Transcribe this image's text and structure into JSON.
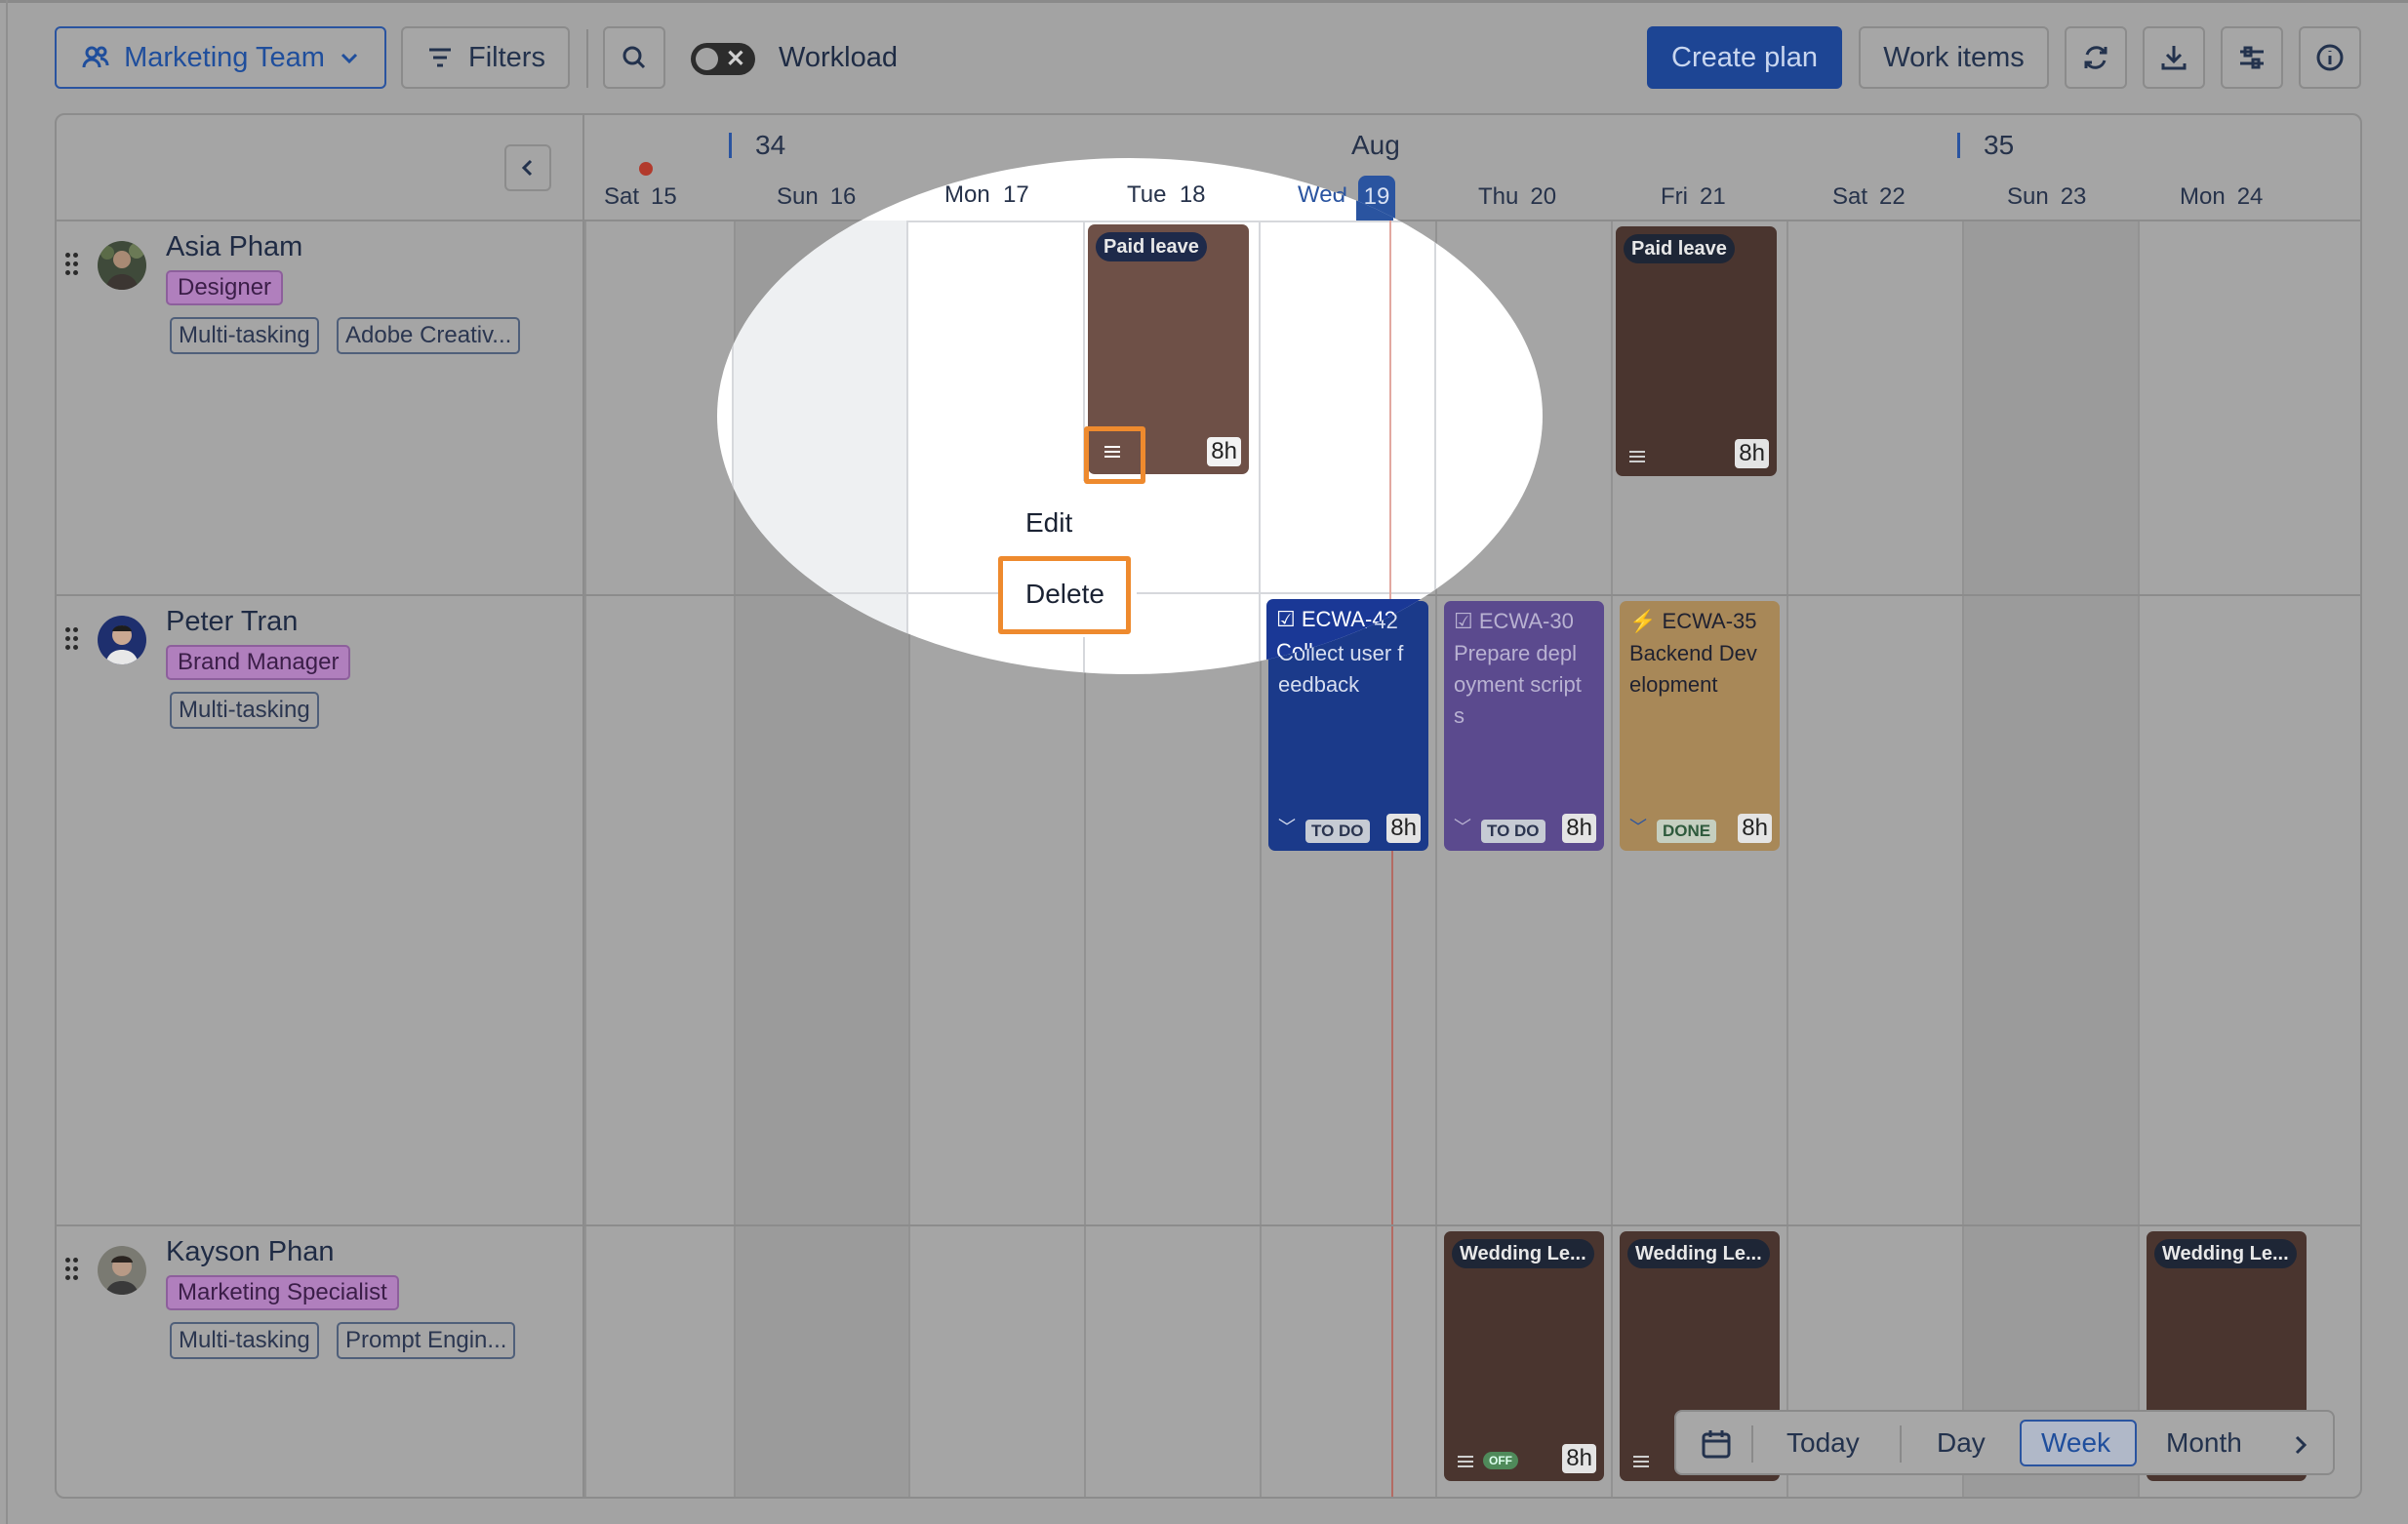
{
  "toolbar": {
    "team_label": "Marketing Team",
    "filters_label": "Filters",
    "workload_label": "Workload",
    "workload_toggle": "off",
    "create_plan_label": "Create plan",
    "work_items_label": "Work items",
    "icons": [
      "users-icon",
      "chevron-down-icon",
      "filter-icon",
      "search-icon",
      "refresh-icon",
      "download-icon",
      "settings-sliders-icon",
      "info-icon"
    ]
  },
  "timeline": {
    "month": "Aug",
    "weeks": [
      "34",
      "35"
    ],
    "days": [
      {
        "name": "Sat",
        "num": "15"
      },
      {
        "name": "Sun",
        "num": "16"
      },
      {
        "name": "Mon",
        "num": "17"
      },
      {
        "name": "Tue",
        "num": "18"
      },
      {
        "name": "Wed",
        "num": "19"
      },
      {
        "name": "Thu",
        "num": "20"
      },
      {
        "name": "Fri",
        "num": "21"
      },
      {
        "name": "Sat",
        "num": "22"
      },
      {
        "name": "Sun",
        "num": "23"
      },
      {
        "name": "Mon",
        "num": "24"
      }
    ],
    "today": "19"
  },
  "people": [
    {
      "name": "Asia Pham",
      "role": "Designer",
      "skills": [
        "Multi-tasking",
        "Adobe Creativ..."
      ]
    },
    {
      "name": "Peter Tran",
      "role": "Brand Manager",
      "skills": [
        "Multi-tasking"
      ]
    },
    {
      "name": "Kayson Phan",
      "role": "Marketing Specialist",
      "skills": [
        "Multi-tasking",
        "Prompt Engin..."
      ]
    }
  ],
  "cards": {
    "paid_leave_label": "Paid leave",
    "wedding_label": "Wedding Le...",
    "hours": "8h",
    "off_label": "OFF",
    "tasks": [
      {
        "key": "ECWA-42",
        "title": "Collect user f eedback",
        "status": "TO DO"
      },
      {
        "key": "ECWA-30",
        "title": "Prepare depl oyment script s",
        "status": "TO DO"
      },
      {
        "key": "ECWA-35",
        "title": "Backend Dev elopment",
        "status": "DONE"
      }
    ]
  },
  "context_menu": {
    "edit_label": "Edit",
    "delete_label": "Delete"
  },
  "bottom_nav": {
    "today_label": "Today",
    "day_label": "Day",
    "week_label": "Week",
    "month_label": "Month",
    "active_view": "Week"
  },
  "colors": {
    "accent": "#1d4594",
    "highlight": "#ee8a2e",
    "role_tag": "#b07fbd",
    "leave_card": "#4a352f",
    "task_blue": "#1b3a8a",
    "task_purple": "#5b4a8e",
    "task_orange": "#a88858"
  }
}
